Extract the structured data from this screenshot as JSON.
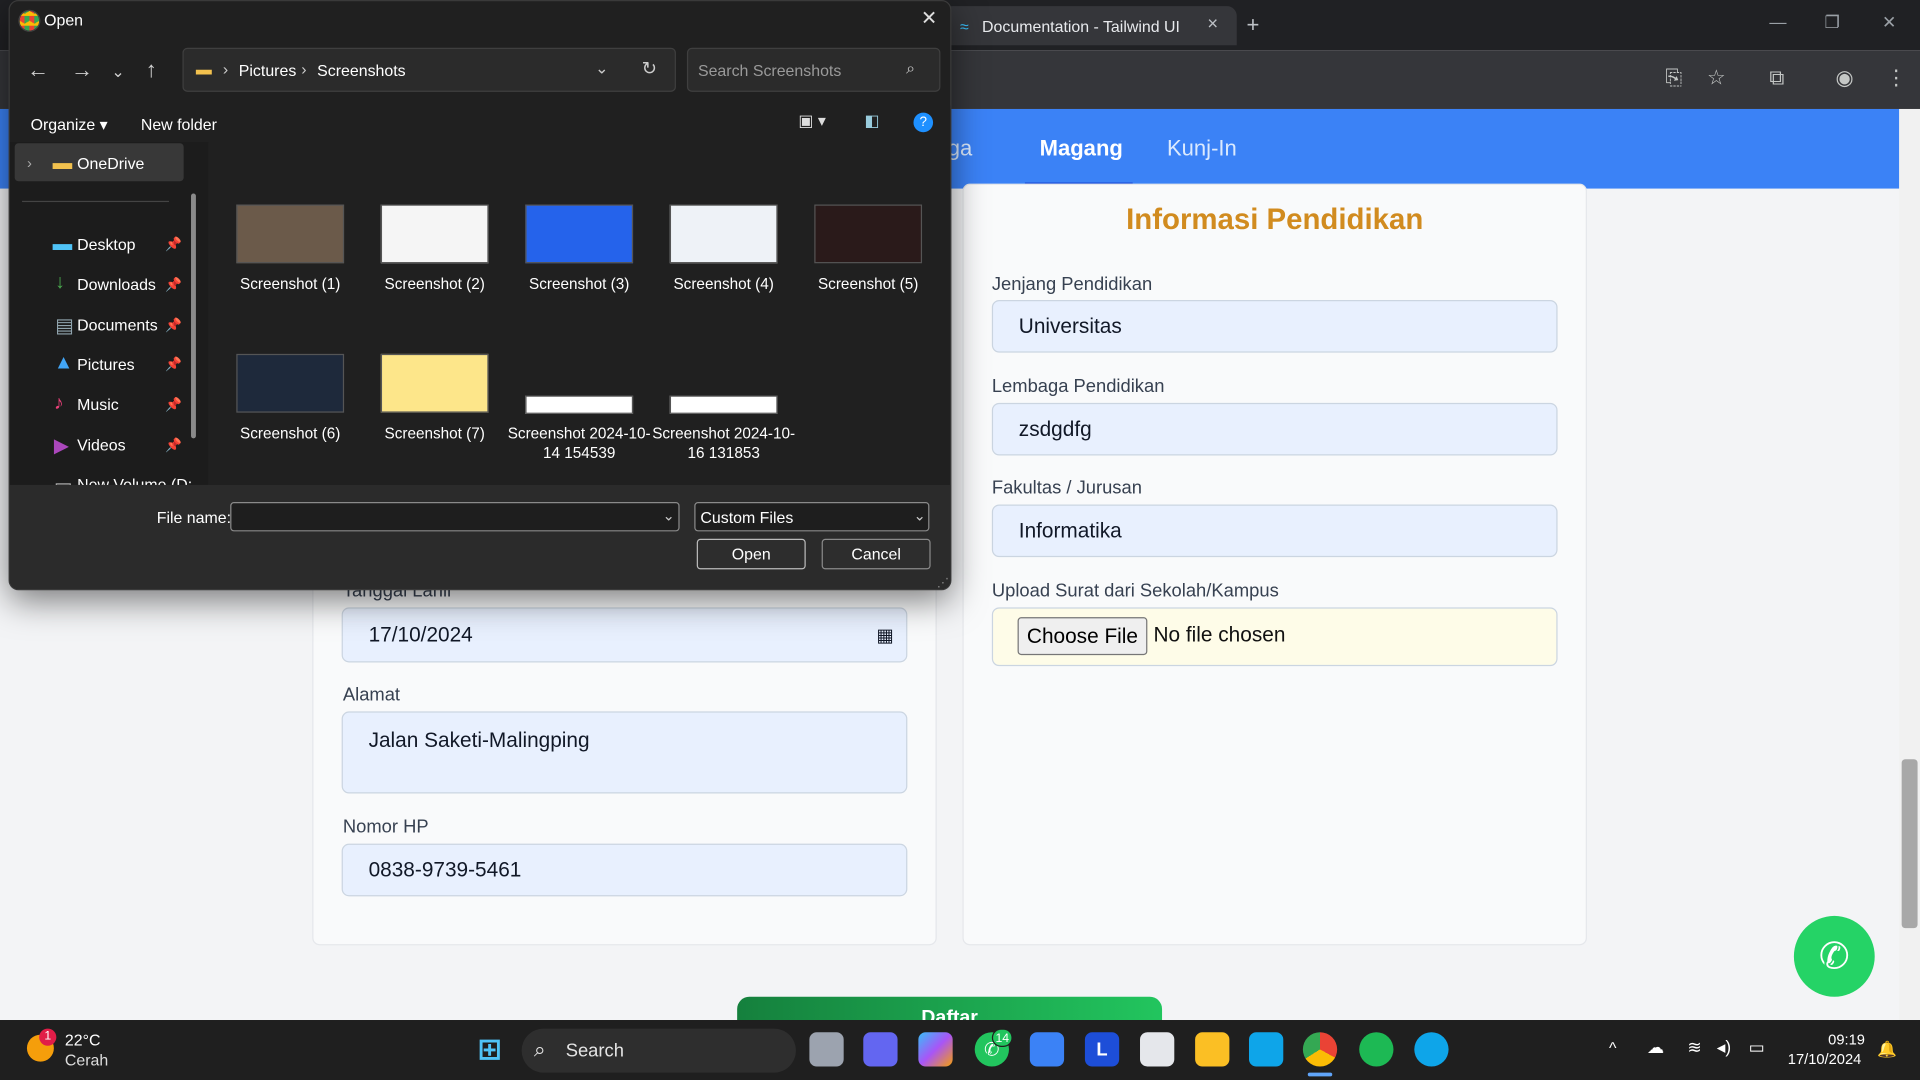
{
  "browser": {
    "tab_title": "Documentation - Tailwind UI",
    "tab_close": "×",
    "new_tab": "+",
    "win_min": "—",
    "win_max": "❐",
    "win_close": "✕"
  },
  "nav": {
    "items": [
      "aga",
      "Magang",
      "Kunj-In"
    ]
  },
  "form_right": {
    "heading": "Informasi Pendidikan",
    "jenjang_label": "Jenjang Pendidikan",
    "jenjang_value": "Universitas",
    "lembaga_label": "Lembaga Pendidikan",
    "lembaga_value": "zsdgdfg",
    "fakultas_label": "Fakultas / Jurusan",
    "fakultas_value": "Informatika",
    "upload_label": "Upload Surat dari Sekolah/Kampus",
    "choose_file": "Choose File",
    "no_file": "No file chosen"
  },
  "form_left": {
    "tanggal_label": "Tanggal Lahir",
    "tanggal_value": "17/10/2024",
    "alamat_label": "Alamat",
    "alamat_value": "Jalan Saketi-Malingping",
    "hp_label": "Nomor HP",
    "hp_value": "0838-9739-5461"
  },
  "submit": {
    "label": "Daftar"
  },
  "dialog": {
    "title": "Open",
    "path": [
      "Pictures",
      "Screenshots"
    ],
    "search_placeholder": "Search Screenshots",
    "organize": "Organize",
    "new_folder": "New folder",
    "help": "?",
    "nav": [
      {
        "label": "OneDrive",
        "pin": false
      },
      {
        "label": "Desktop",
        "pin": true
      },
      {
        "label": "Downloads",
        "pin": true
      },
      {
        "label": "Documents",
        "pin": true
      },
      {
        "label": "Pictures",
        "pin": true
      },
      {
        "label": "Music",
        "pin": true
      },
      {
        "label": "Videos",
        "pin": true
      },
      {
        "label": "New Volume (D:",
        "pin": false
      }
    ],
    "files": [
      {
        "label": "Screenshot (1)",
        "color": "#6b5a4a"
      },
      {
        "label": "Screenshot (2)",
        "color": "#f5f5f5"
      },
      {
        "label": "Screenshot (3)",
        "color": "#2563eb"
      },
      {
        "label": "Screenshot (4)",
        "color": "#eef2f7"
      },
      {
        "label": "Screenshot (5)",
        "color": "#2a1a1a"
      },
      {
        "label": "Screenshot (6)",
        "color": "#1e293b"
      },
      {
        "label": "Screenshot (7)",
        "color": "#fde68a"
      },
      {
        "label": "Screenshot 2024-10-14 154539",
        "color": "#ffffff"
      },
      {
        "label": "Screenshot 2024-10-16 131853",
        "color": "#ffffff"
      }
    ],
    "file_name_label": "File name:",
    "file_name_value": "",
    "file_type": "Custom Files",
    "open_label": "Open",
    "cancel_label": "Cancel"
  },
  "taskbar": {
    "weather_temp": "22°C",
    "weather_desc": "Cerah",
    "weather_badge": "1",
    "search_label": "Search",
    "whatsapp_badge": "14",
    "time": "09:19",
    "date": "17/10/2024"
  }
}
